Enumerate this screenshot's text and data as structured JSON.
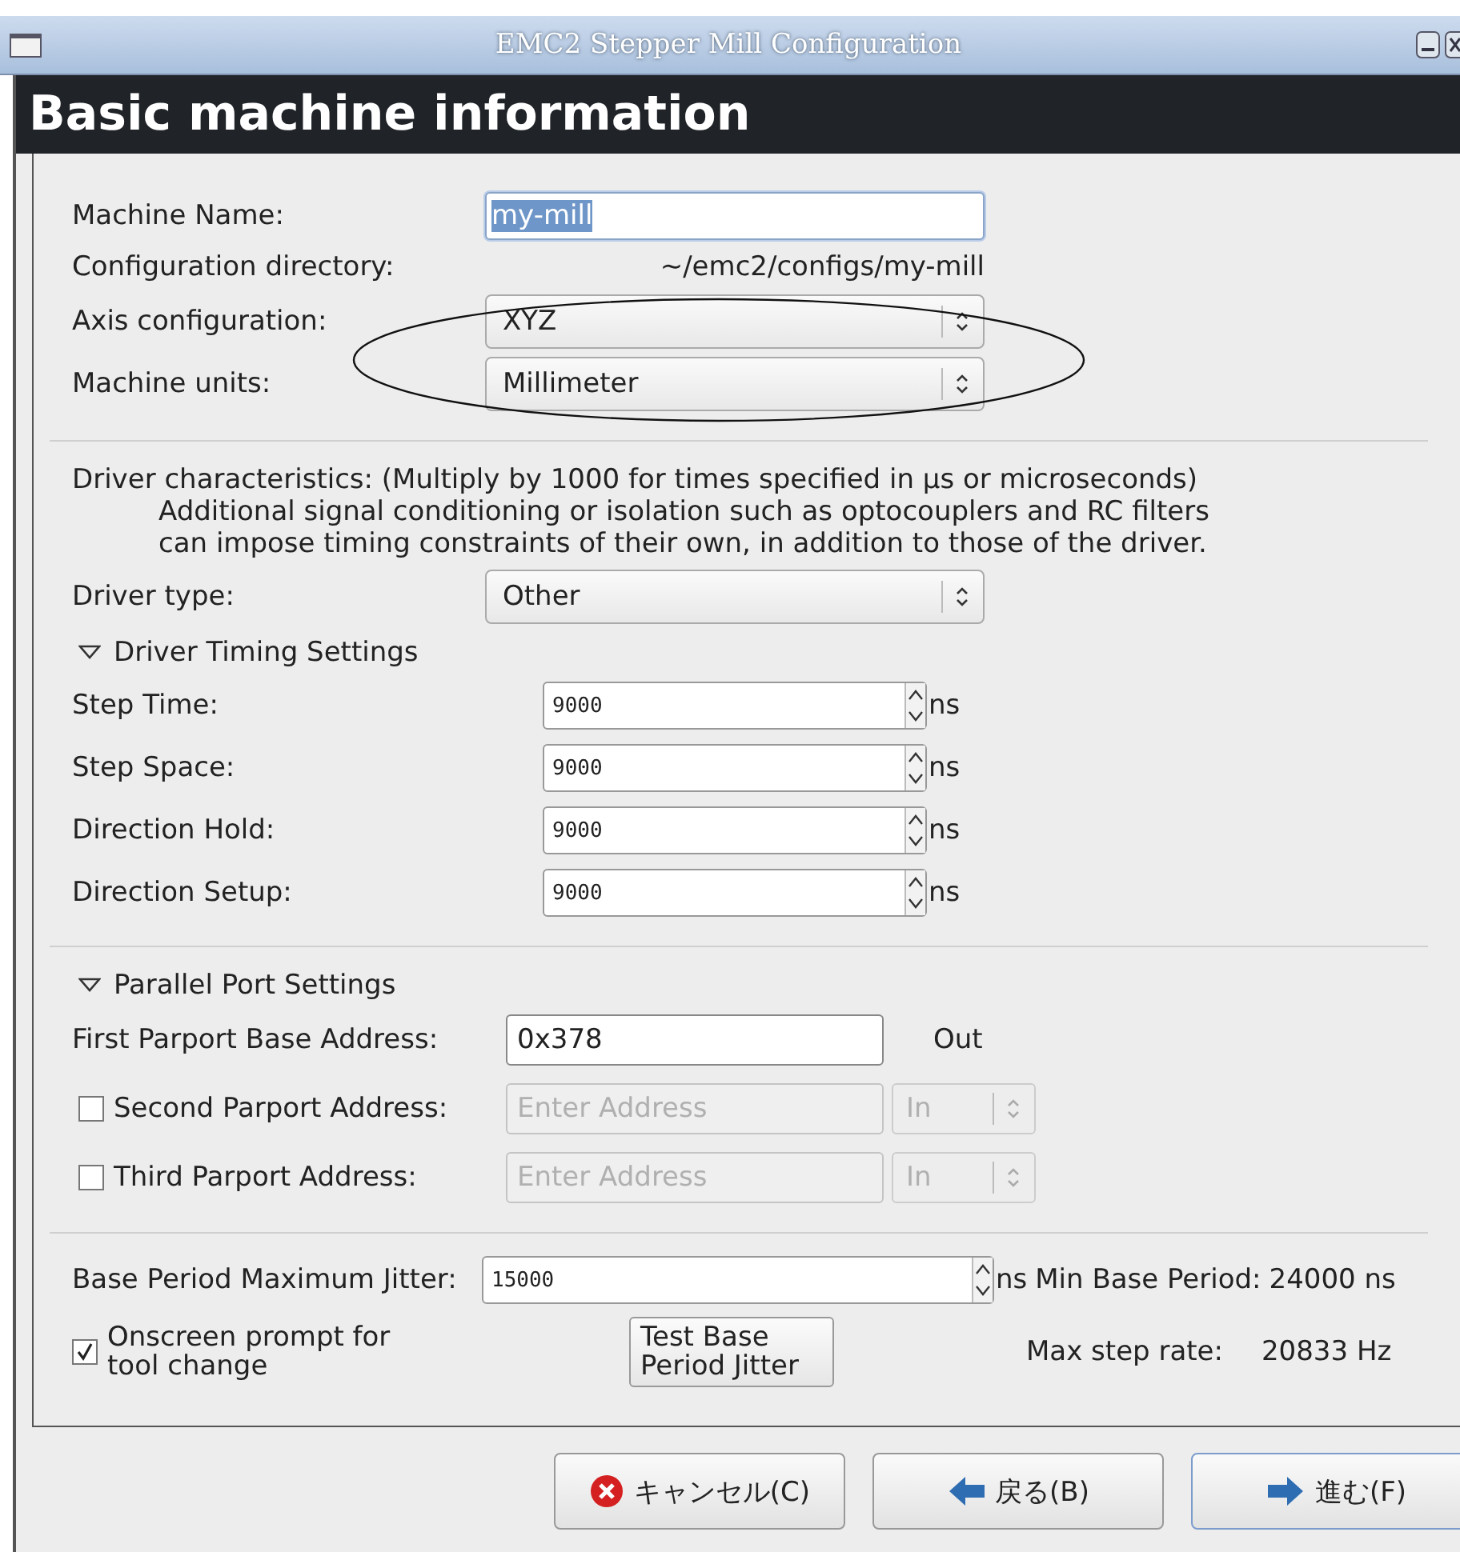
{
  "window": {
    "title": "EMC2 Stepper Mill Configuration"
  },
  "header": {
    "title": "Basic machine information"
  },
  "machine": [
    {
      "kind": "entry",
      "label": "Machine Name:",
      "value": "my-mill",
      "selected": true
    },
    {
      "kind": "info",
      "label": "Configuration directory:",
      "value": "~/emc2/configs/my-mill"
    },
    {
      "kind": "combo",
      "label": "Axis configuration:",
      "value": "XYZ"
    },
    {
      "kind": "combo",
      "label": "Machine units:",
      "value": "Millimeter"
    }
  ],
  "driver": {
    "note": "Driver characteristics: (Multiply by 1000 for times specified in µs or microseconds)",
    "details": [
      "Additional signal conditioning or isolation such as optocouplers and RC filters",
      "can impose timing constraints of their own, in addition to those of the driver."
    ],
    "type_label": "Driver type:",
    "type_value": "Other"
  },
  "timing": {
    "label": "Driver Timing Settings",
    "expanded": true,
    "rows": [
      {
        "label": "Step Time:",
        "value": "9000",
        "unit": "ns"
      },
      {
        "label": "Step Space:",
        "value": "9000",
        "unit": "ns"
      },
      {
        "label": "Direction Hold:",
        "value": "9000",
        "unit": "ns"
      },
      {
        "label": "Direction Setup:",
        "value": "9000",
        "unit": "ns"
      }
    ]
  },
  "parport": {
    "label": "Parallel Port Settings",
    "expanded": true,
    "rows": [
      {
        "kind": "plain",
        "label": "First Parport Base Address:",
        "value": "0x378",
        "direction": "Out",
        "disabled": false
      },
      {
        "kind": "checkbox",
        "label": "Second Parport Address:",
        "checked": false,
        "placeholder": "Enter Address",
        "direction": "In",
        "disabled": true
      },
      {
        "kind": "checkbox",
        "label": "Third Parport Address:",
        "checked": false,
        "placeholder": "Enter Address",
        "direction": "In",
        "disabled": true
      }
    ]
  },
  "jitter": {
    "label": "Base Period Maximum Jitter:",
    "value": "15000",
    "unit": "ns",
    "min_label": "Min Base Period:",
    "min_value": "24000 ns",
    "prompt": {
      "label": "Onscreen prompt for tool change",
      "checked": true
    },
    "test_button": "Test Base Period Jitter",
    "rate_label": "Max step rate:",
    "rate_value": "20833 Hz"
  },
  "buttons": [
    {
      "kind": "cancel",
      "label": "キャンセル(C)"
    },
    {
      "kind": "back",
      "label": "戻る(B)"
    },
    {
      "kind": "forward",
      "label": "進む(F)"
    }
  ]
}
